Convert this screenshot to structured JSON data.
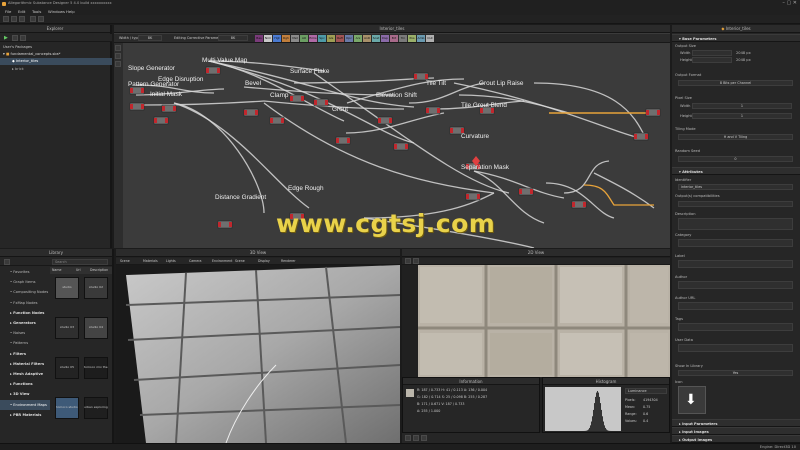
{
  "window": {
    "title": "Allegorithmic Substance Designer 5 4.0 build xxxxxxxxxx"
  },
  "menu": [
    "File",
    "Edit",
    "Tools",
    "Windows",
    "Help"
  ],
  "explorer": {
    "title": "Explorer",
    "section": "User's Packages",
    "package": "fundamental_concepts.sbs*",
    "graph": "Interior_tiles",
    "resource": "brick"
  },
  "graph_view": {
    "title": "Interior_tiles",
    "toolbar": {
      "width_label": "Width / type",
      "width_value": "8K",
      "quality_label": "Editing Corrective Parameters",
      "quality_value": "8K"
    },
    "channels": [
      "Bas",
      "Nrm",
      "Hgt",
      "Rgh",
      "Met",
      "AO",
      "Emis",
      "Spc",
      "Gls",
      "Refl",
      "Opc",
      "Ani",
      "AnR",
      "Scat",
      "Dsp",
      "Brt",
      "Trn",
      "Pos",
      "Amb",
      "Out"
    ],
    "nodes": [
      {
        "id": "slope-generator",
        "label": "Slope Generator"
      },
      {
        "id": "pattern-generator",
        "label": "Pattern Generator"
      },
      {
        "id": "edge-disruption",
        "label": "Edge Disruption"
      },
      {
        "id": "initial-mask",
        "label": "Initial Mask"
      },
      {
        "id": "multi-value-map",
        "label": "Multi Value Map"
      },
      {
        "id": "bevel",
        "label": "Bevel"
      },
      {
        "id": "clamp",
        "label": "Clamp"
      },
      {
        "id": "surface-flake",
        "label": "Surface Flake"
      },
      {
        "id": "grout",
        "label": "Grout"
      },
      {
        "id": "elevation-shift",
        "label": "Elevation Shift"
      },
      {
        "id": "tile-tilt",
        "label": "Tile Tilt"
      },
      {
        "id": "grout-lip-raise",
        "label": "Grout Lip Raise"
      },
      {
        "id": "tile-grout-blend",
        "label": "Tile Grout Blend"
      },
      {
        "id": "curvature",
        "label": "Curvature"
      },
      {
        "id": "separation-mask",
        "label": "Separation Mask"
      },
      {
        "id": "edge-rough",
        "label": "Edge Rough"
      },
      {
        "id": "distance-gradient",
        "label": "Distance Gradient"
      }
    ]
  },
  "watermark": "www.cgtsj.com",
  "library": {
    "title": "Library",
    "search_placeholder": "Search",
    "columns": [
      "Name",
      "Url",
      "Description"
    ],
    "categories": [
      {
        "label": "Favorites",
        "bold": false
      },
      {
        "label": "Graph Items",
        "bold": false
      },
      {
        "label": "Compositing Nodes",
        "bold": false
      },
      {
        "label": "FxMap Nodes",
        "bold": false
      },
      {
        "label": "Function Nodes",
        "bold": true
      },
      {
        "label": "Generators",
        "bold": true
      },
      {
        "label": "Noises",
        "bold": false
      },
      {
        "label": "Patterns",
        "bold": false
      },
      {
        "label": "Filters",
        "bold": true
      },
      {
        "label": "Material Filters",
        "bold": true
      },
      {
        "label": "Mesh Adaptive",
        "bold": true
      },
      {
        "label": "Functions",
        "bold": true
      },
      {
        "label": "3D View",
        "bold": true
      },
      {
        "label": "Environment Maps",
        "bold": false
      },
      {
        "label": "PBR Materials",
        "bold": true
      }
    ],
    "thumbs": [
      "studio",
      "studio 02",
      "studio 03",
      "studio 04",
      "studio 05",
      "tomoco mix the grounds",
      "tomoco studio",
      "urban exploring interior"
    ]
  },
  "view3d": {
    "title": "3D View",
    "menu": [
      "Scene",
      "Materials",
      "Lights",
      "Camera",
      "Environment",
      "Scene",
      "Display",
      "Renderer"
    ]
  },
  "view2d": {
    "title": "2D View",
    "information": {
      "title": "Information",
      "rows": [
        "R: 187 / 0.733  H: 41 / 0.113  A: 136 / 0.004",
        "G: 182 / 0.714  S: 25 / 0.098  B: 255 / 0.287",
        "B: 171 / 0.671  V: 187 / 0.733",
        "A: 255 / 1.000"
      ]
    },
    "histogram": {
      "title": "Histogram",
      "mode": "Luminance",
      "stats": [
        {
          "k": "Pixels:",
          "v": "4194304"
        },
        {
          "k": "Mean:",
          "v": "0.75"
        },
        {
          "k": "Range:",
          "v": "0.6"
        },
        {
          "k": "Values:",
          "v": "0.4"
        }
      ]
    }
  },
  "parameters": {
    "title": "Interior_tiles",
    "base_section": "Base Parameters",
    "output_size": {
      "label": "Output Size",
      "width_label": "Width",
      "width_value": "2048 px",
      "height_label": "Height",
      "height_value": "2048 px"
    },
    "output_format": {
      "label": "Output Format",
      "value": "8 Bits per Channel"
    },
    "pixel_size": {
      "label": "Pixel Size",
      "width_label": "Width",
      "width_value": "1",
      "height_label": "Height",
      "height_value": "1"
    },
    "tiling_mode": {
      "label": "Tiling Mode",
      "value": "H and V Tiling"
    },
    "random_seed": {
      "label": "Random Seed",
      "value": "0"
    },
    "attributes_section": "Attributes",
    "identifier": {
      "label": "Identifier",
      "value": "interior_tiles"
    },
    "output_sizes_label": "Output(s) compatibilities",
    "fields": [
      "Description",
      "Category",
      "Label",
      "Author",
      "Author URL",
      "Tags",
      "User Data"
    ],
    "show_in_library": "Show In Library",
    "show_in_library_value": "Yes",
    "icon": "Icon",
    "bottom_sections": [
      "Input Parameters",
      "Input Images",
      "Output Images"
    ]
  },
  "status": {
    "engine": "Engine: Direct3D 10"
  },
  "colors": {
    "accent": "#e8a33a",
    "panel": "#2b2b2b",
    "graph_bg": "#3d3d3d",
    "node": "#6f6f6f",
    "link": "#d8d8d8"
  }
}
